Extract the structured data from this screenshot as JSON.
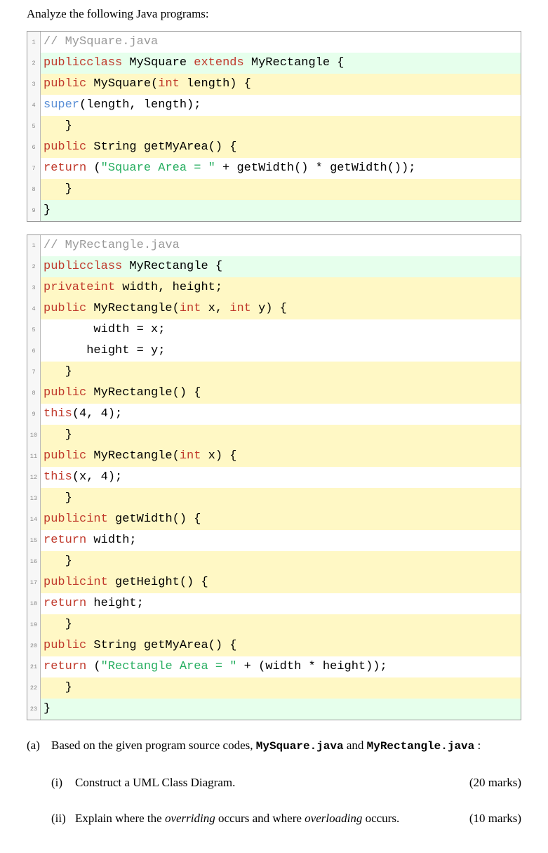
{
  "heading": "Analyze the following Java programs:",
  "code1": {
    "lines": [
      {
        "n": "1",
        "hl": "none",
        "html": "<span class='tok-comment'>// MySquare.java</span>"
      },
      {
        "n": "2",
        "hl": "green",
        "html": "<span class='tok-kw'>public</span> <span class='tok-kw'>class</span> MySquare <span class='tok-kw'>extends</span> MyRectangle {"
      },
      {
        "n": "3",
        "hl": "yellow",
        "html": "      <span class='tok-kw'>public</span> MySquare(<span class='tok-type'>int</span> length) {"
      },
      {
        "n": "4",
        "hl": "none",
        "html": "          <span class='tok-super'>super</span>(length, length);"
      },
      {
        "n": "5",
        "hl": "yellow",
        "html": "   }"
      },
      {
        "n": "6",
        "hl": "yellow",
        "html": "   <span class='tok-kw'>public</span> String getMyArea() {"
      },
      {
        "n": "7",
        "hl": "none",
        "html": "          <span class='tok-kw'>return</span> (<span class='tok-str'>\"Square Area = \"</span> + getWidth() * getWidth());"
      },
      {
        "n": "8",
        "hl": "yellow",
        "html": "   }"
      },
      {
        "n": "9",
        "hl": "green",
        "html": "}"
      }
    ]
  },
  "code2": {
    "lines": [
      {
        "n": "1",
        "hl": "none",
        "html": "<span class='tok-comment'>// MyRectangle.java</span>"
      },
      {
        "n": "2",
        "hl": "green",
        "html": "<span class='tok-kw'>public</span> <span class='tok-kw'>class</span> MyRectangle {"
      },
      {
        "n": "3",
        "hl": "yellow",
        "html": "   <span class='tok-kw'>private</span> <span class='tok-type'>int</span> width, height;"
      },
      {
        "n": "4",
        "hl": "yellow",
        "html": "      <span class='tok-kw'>public</span> MyRectangle(<span class='tok-type'>int</span> x, <span class='tok-type'>int</span> y) {"
      },
      {
        "n": "5",
        "hl": "none",
        "html": "       width = x;"
      },
      {
        "n": "6",
        "hl": "none",
        "html": "      height = y;"
      },
      {
        "n": "7",
        "hl": "yellow",
        "html": "   }"
      },
      {
        "n": "8",
        "hl": "yellow",
        "html": "   <span class='tok-kw'>public</span> MyRectangle() {"
      },
      {
        "n": "9",
        "hl": "none",
        "html": "       <span class='tok-this'>this</span>(4, 4);"
      },
      {
        "n": "10",
        "hl": "yellow",
        "html": "   }"
      },
      {
        "n": "11",
        "hl": "yellow",
        "html": "   <span class='tok-kw'>public</span> MyRectangle(<span class='tok-type'>int</span> x) {"
      },
      {
        "n": "12",
        "hl": "none",
        "html": "      <span class='tok-this'>this</span>(x, 4);"
      },
      {
        "n": "13",
        "hl": "yellow",
        "html": "   }"
      },
      {
        "n": "14",
        "hl": "yellow",
        "html": "   <span class='tok-kw'>public</span> <span class='tok-type'>int</span> getWidth() {"
      },
      {
        "n": "15",
        "hl": "none",
        "html": "      <span class='tok-kw'>return</span> width;"
      },
      {
        "n": "16",
        "hl": "yellow",
        "html": "   }"
      },
      {
        "n": "17",
        "hl": "yellow",
        "html": "   <span class='tok-kw'>public</span> <span class='tok-type'>int</span> getHeight() {"
      },
      {
        "n": "18",
        "hl": "none",
        "html": "      <span class='tok-kw'>return</span> height;"
      },
      {
        "n": "19",
        "hl": "yellow",
        "html": "   }"
      },
      {
        "n": "20",
        "hl": "yellow",
        "html": "   <span class='tok-kw'>public</span> String getMyArea() {"
      },
      {
        "n": "21",
        "hl": "none",
        "html": "         <span class='tok-kw'>return</span> (<span class='tok-str'>\"Rectangle Area = \"</span> + (width * height));"
      },
      {
        "n": "22",
        "hl": "yellow",
        "html": "   }"
      },
      {
        "n": "23",
        "hl": "green",
        "html": "}"
      }
    ]
  },
  "qa": {
    "a_label": "(a)",
    "a_text_pre": "Based on the given program source codes, ",
    "a_file1": "MySquare.java",
    "a_mid": " and ",
    "a_file2": "MyRectangle.java",
    "a_suffix": " :",
    "i_label": "(i)",
    "i_text": "Construct a UML Class Diagram.",
    "i_marks": "(20 marks)",
    "ii_label": "(ii)",
    "ii_pre": "Explain where the ",
    "ii_em1": "overriding",
    "ii_mid": " occurs and where ",
    "ii_em2": "overloading",
    "ii_post": " occurs.",
    "ii_marks": "(10 marks)"
  }
}
